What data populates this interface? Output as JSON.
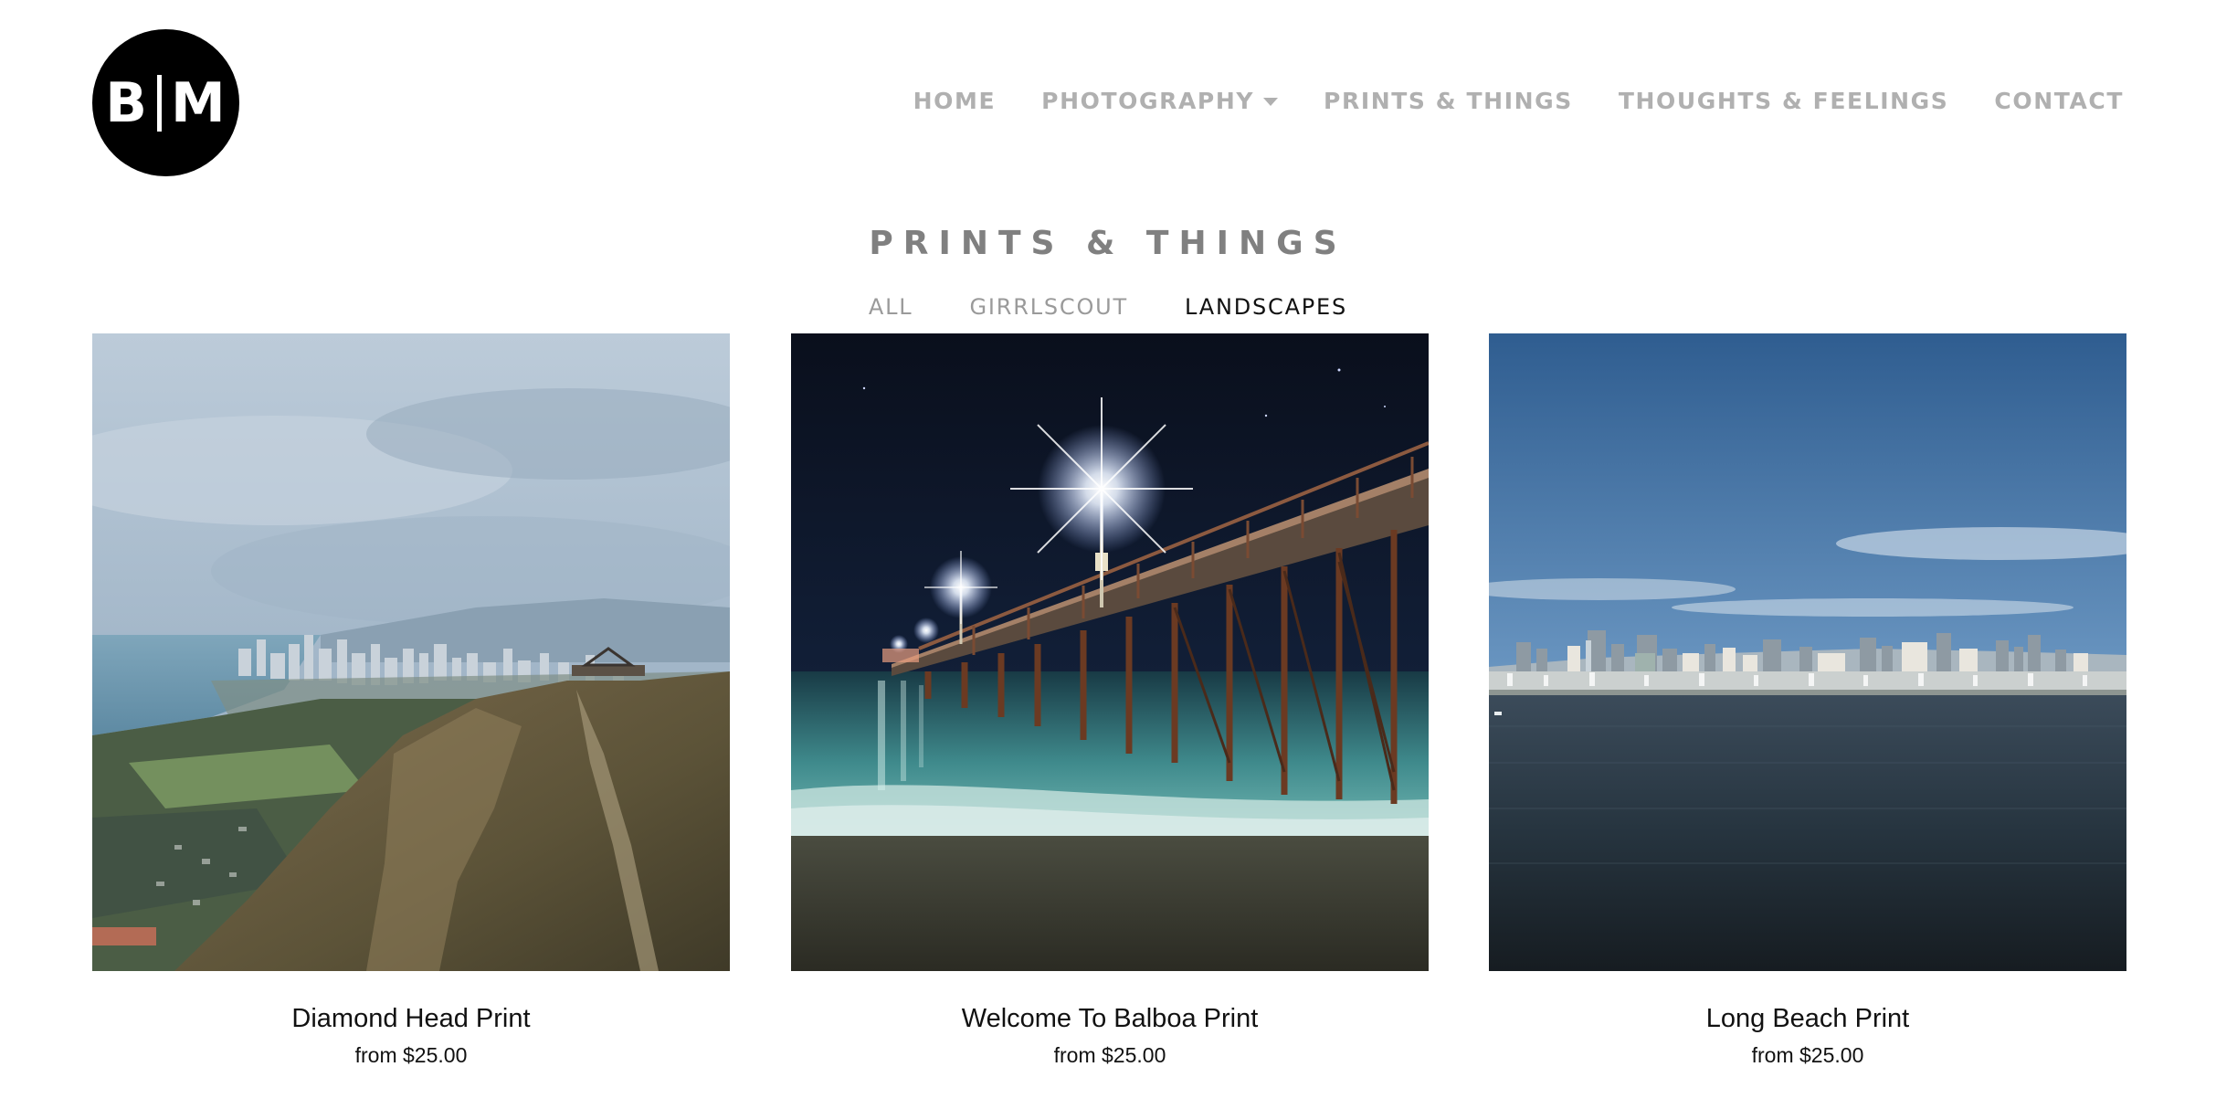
{
  "brand": {
    "logo_left": "B",
    "logo_right": "M"
  },
  "nav": {
    "items": [
      {
        "label": "HOME"
      },
      {
        "label": "PHOTOGRAPHY",
        "has_dropdown": true
      },
      {
        "label": "PRINTS & THINGS"
      },
      {
        "label": "THOUGHTS & FEELINGS"
      },
      {
        "label": "CONTACT"
      }
    ]
  },
  "page": {
    "title": "PRINTS & THINGS",
    "filters": [
      {
        "label": "ALL",
        "active": false
      },
      {
        "label": "GIRRLSCOUT",
        "active": false
      },
      {
        "label": "LANDSCAPES",
        "active": true
      }
    ]
  },
  "products": [
    {
      "name": "Diamond Head Print",
      "price": "from $25.00",
      "image": "diamond-head-landscape-photo"
    },
    {
      "name": "Welcome To Balboa Print",
      "price": "from $25.00",
      "image": "balboa-pier-night-photo"
    },
    {
      "name": "Long Beach Print",
      "price": "from $25.00",
      "image": "long-beach-skyline-photo"
    }
  ],
  "colors": {
    "nav_text": "#b0b0b0",
    "title_text": "#808080",
    "active_filter": "#111111",
    "logo_bg": "#000000"
  }
}
